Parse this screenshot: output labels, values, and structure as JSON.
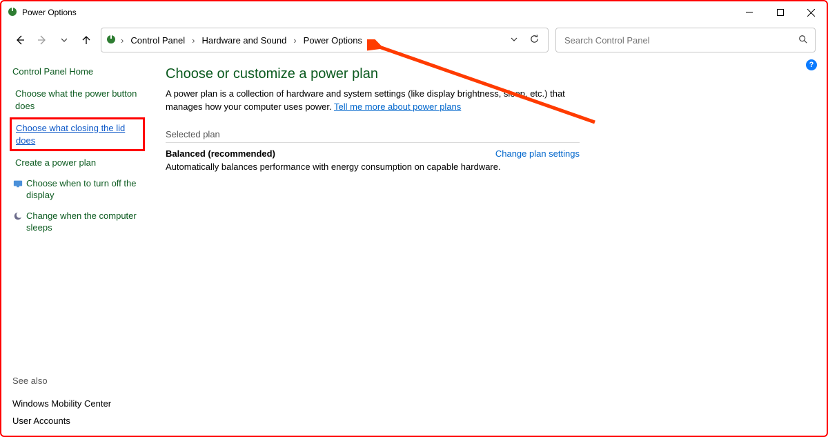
{
  "window": {
    "title": "Power Options"
  },
  "breadcrumb": [
    "Control Panel",
    "Hardware and Sound",
    "Power Options"
  ],
  "search": {
    "placeholder": "Search Control Panel"
  },
  "sidebar": {
    "home": "Control Panel Home",
    "items": [
      "Choose what the power button does",
      "Choose what closing the lid does",
      "Create a power plan",
      "Choose when to turn off the display",
      "Change when the computer sleeps"
    ],
    "see_also_label": "See also",
    "see_also": [
      "Windows Mobility Center",
      "User Accounts"
    ]
  },
  "main": {
    "heading": "Choose or customize a power plan",
    "desc_pre": "A power plan is a collection of hardware and system settings (like display brightness, sleep, etc.) that manages how your computer uses power. ",
    "desc_link": "Tell me more about power plans",
    "section_label": "Selected plan",
    "plan_name": "Balanced (recommended)",
    "plan_link": "Change plan settings",
    "plan_desc": "Automatically balances performance with energy consumption on capable hardware."
  },
  "help": "?"
}
